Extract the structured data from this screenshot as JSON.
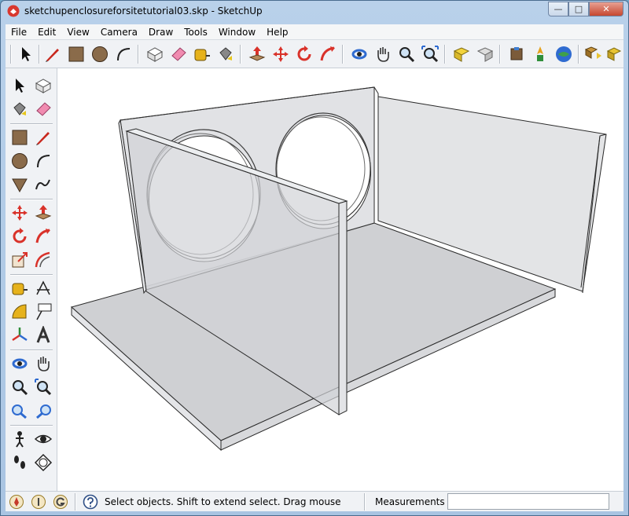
{
  "window": {
    "title": "sketchupenclosureforsitetutorial03.skp - SketchUp",
    "minimize_glyph": "—",
    "maximize_glyph": "□",
    "close_glyph": "✕"
  },
  "menu": [
    {
      "label": "File"
    },
    {
      "label": "Edit"
    },
    {
      "label": "View"
    },
    {
      "label": "Camera"
    },
    {
      "label": "Draw"
    },
    {
      "label": "Tools"
    },
    {
      "label": "Window"
    },
    {
      "label": "Help"
    }
  ],
  "toolbar": {
    "icons": [
      "select-icon",
      "pencil-line-icon",
      "rectangle-icon",
      "circle-icon",
      "arc-icon",
      "make-component-icon",
      "eraser-icon",
      "tape-measure-icon",
      "paint-bucket-icon",
      "push-pull-icon",
      "move-icon",
      "rotate-icon",
      "follow-me-icon",
      "orbit-icon",
      "pan-icon",
      "zoom-icon",
      "zoom-extents-icon",
      "get-models-icon",
      "share-model-icon",
      "share-component-icon",
      "place-model-icon",
      "google-earth-icon",
      "component-exchange-icon"
    ]
  },
  "status": {
    "hint": "Select objects. Shift to extend select. Drag mouse",
    "measurements_label": "Measurements",
    "measurements_value": ""
  },
  "colors": {
    "accent": "#3a78c2",
    "model_face": "#c8c9cc",
    "model_edge": "#2a2a2a"
  }
}
